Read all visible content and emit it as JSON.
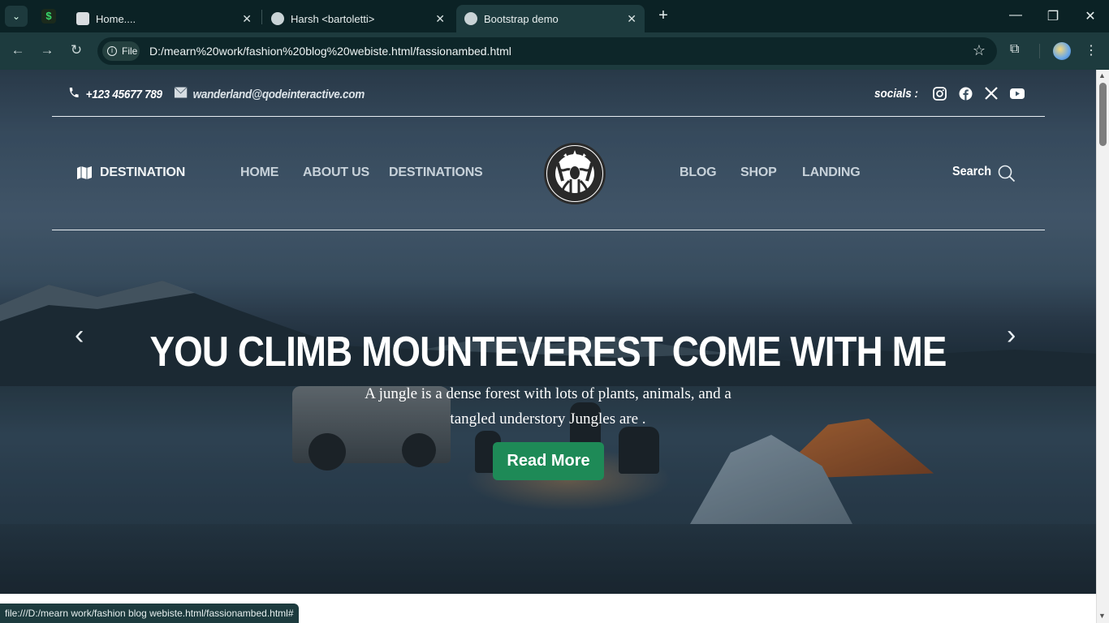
{
  "browser": {
    "tabs": [
      {
        "title": "Home...."
      },
      {
        "title": "Harsh <bartoletti>"
      },
      {
        "title": "Bootstrap demo"
      }
    ],
    "url_chip": "File",
    "url": "D:/mearn%20work/fashion%20blog%20webiste.html/fassionambed.html",
    "status_url": "file:///D:/mearn work/fashion blog webiste.html/fassionambed.html#"
  },
  "page": {
    "contact": {
      "phone": "+123 45677 789",
      "email": "wanderland@qodeinteractive.com"
    },
    "socials_label": "socials :",
    "social_icons": [
      "instagram-icon",
      "facebook-icon",
      "x-icon",
      "youtube-icon"
    ],
    "nav": {
      "brand": "DESTINATION",
      "left": [
        "HOME",
        "ABOUT US",
        "DESTINATIONS"
      ],
      "right": [
        "BLOG",
        "SHOP",
        "LANDING"
      ],
      "search": "Search"
    },
    "hero": {
      "title": "YOU CLIMB MOUNTEVEREST COME WITH ME",
      "text": "A jungle is a dense forest with lots of plants, animals, and a tangled understory Jungles are .",
      "button": "Read More",
      "prev": "‹",
      "next": "›"
    },
    "colors": {
      "accent": "#1e8a57",
      "browser_frame": "#0b2225",
      "toolbar": "#1d3b3e"
    }
  }
}
